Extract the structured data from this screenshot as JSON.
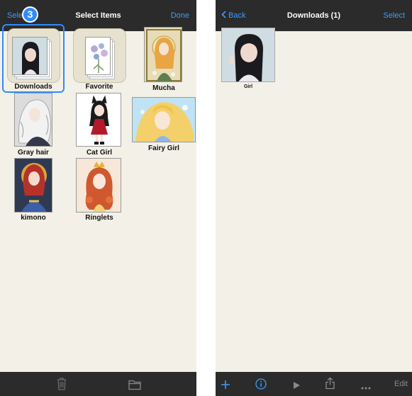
{
  "left_screen": {
    "nav": {
      "left_button": "Sele",
      "title": "Select Items",
      "right_button": "Done"
    },
    "step_badge": "3",
    "items": [
      {
        "label": "Downloads",
        "kind": "folder",
        "selected": true
      },
      {
        "label": "Favorite",
        "kind": "folder",
        "selected": false
      },
      {
        "label": "Mucha",
        "kind": "image",
        "selected": false
      },
      {
        "label": "Gray hair",
        "kind": "image",
        "selected": false
      },
      {
        "label": "Cat Girl",
        "kind": "image",
        "selected": false
      },
      {
        "label": "Fairy Girl",
        "kind": "image",
        "selected": false
      },
      {
        "label": "kimono",
        "kind": "image",
        "selected": false
      },
      {
        "label": "Ringlets",
        "kind": "image",
        "selected": false
      }
    ],
    "toolbar": {
      "icons": [
        "trash-icon",
        "folder-icon"
      ]
    }
  },
  "right_screen": {
    "nav": {
      "back_label": "Back",
      "title": "Downloads (1)",
      "right_button": "Select"
    },
    "items": [
      {
        "label": "Girl",
        "kind": "image"
      }
    ],
    "toolbar": {
      "icons": [
        "plus-icon",
        "info-icon",
        "play-icon",
        "share-icon",
        "more-icon"
      ],
      "edit_label": "Edit"
    }
  },
  "colors": {
    "accent": "#3d9bff",
    "selection": "#2f8bff",
    "bar_bg": "#2b2b2b",
    "content_bg": "#f3f1e7"
  }
}
